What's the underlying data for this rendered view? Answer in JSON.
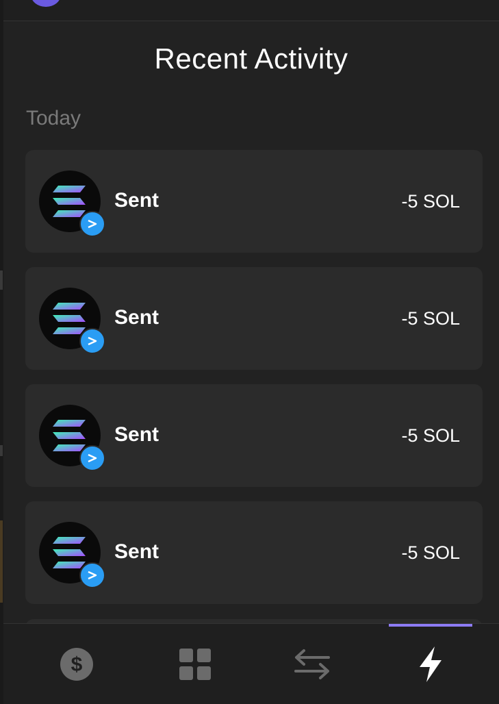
{
  "header": {
    "title": "Recent Activity"
  },
  "section": {
    "label": "Today"
  },
  "activity": [
    {
      "label": "Sent",
      "amount": "-5 SOL",
      "token_icon": "solana-icon",
      "badge_icon": "send-arrow-icon"
    },
    {
      "label": "Sent",
      "amount": "-5 SOL",
      "token_icon": "solana-icon",
      "badge_icon": "send-arrow-icon"
    },
    {
      "label": "Sent",
      "amount": "-5 SOL",
      "token_icon": "solana-icon",
      "badge_icon": "send-arrow-icon"
    },
    {
      "label": "Sent",
      "amount": "-5 SOL",
      "token_icon": "solana-icon",
      "badge_icon": "send-arrow-icon"
    }
  ],
  "nav": {
    "items": [
      {
        "name": "balance",
        "icon": "dollar-coin-icon",
        "active": false
      },
      {
        "name": "collectibles",
        "icon": "grid-icon",
        "active": false
      },
      {
        "name": "swap",
        "icon": "swap-arrows-icon",
        "active": false
      },
      {
        "name": "activity",
        "icon": "lightning-icon",
        "active": true
      }
    ]
  },
  "colors": {
    "background": "#222222",
    "card": "#2b2b2b",
    "accent": "#8d7cf5",
    "badge": "#2a9df4",
    "muted_text": "#7a7a7a"
  }
}
